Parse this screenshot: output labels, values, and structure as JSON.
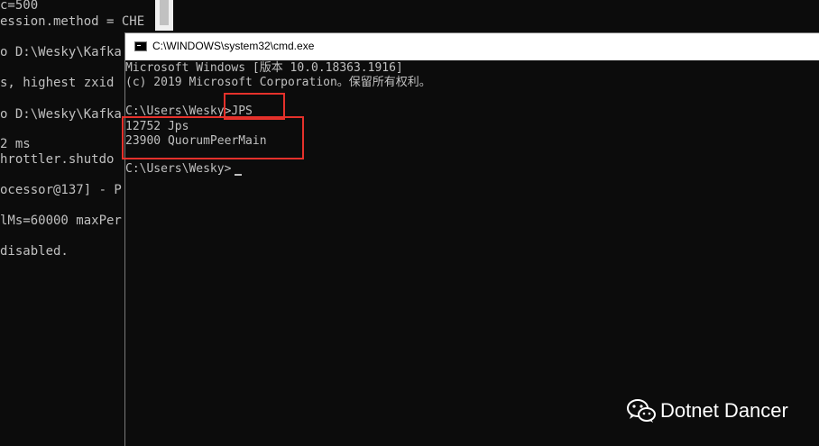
{
  "background_console": {
    "lines": [
      "c=500",
      "ession.method = CHE",
      "o D:\\Wesky\\Kafka",
      "s, highest zxid",
      "o D:\\Wesky\\Kafka",
      "2 ms",
      "hrottler.shutdo",
      "ocessor@137] - P",
      "lMs=60000 maxPer",
      "disabled."
    ]
  },
  "cmd": {
    "title": "C:\\WINDOWS\\system32\\cmd.exe",
    "lines": [
      "Microsoft Windows [版本 10.0.18363.1916]",
      "(c) 2019 Microsoft Corporation。保留所有权利。",
      "",
      "C:\\Users\\Wesky>JPS",
      "12752 Jps",
      "23900 QuorumPeerMain",
      "",
      "C:\\Users\\Wesky>"
    ]
  },
  "watermark": {
    "icon": "wechat-icon",
    "text": "Dotnet Dancer"
  },
  "colors": {
    "console_bg": "#0c0c0c",
    "console_text": "#c0c0c0",
    "highlight": "#e5312b"
  }
}
